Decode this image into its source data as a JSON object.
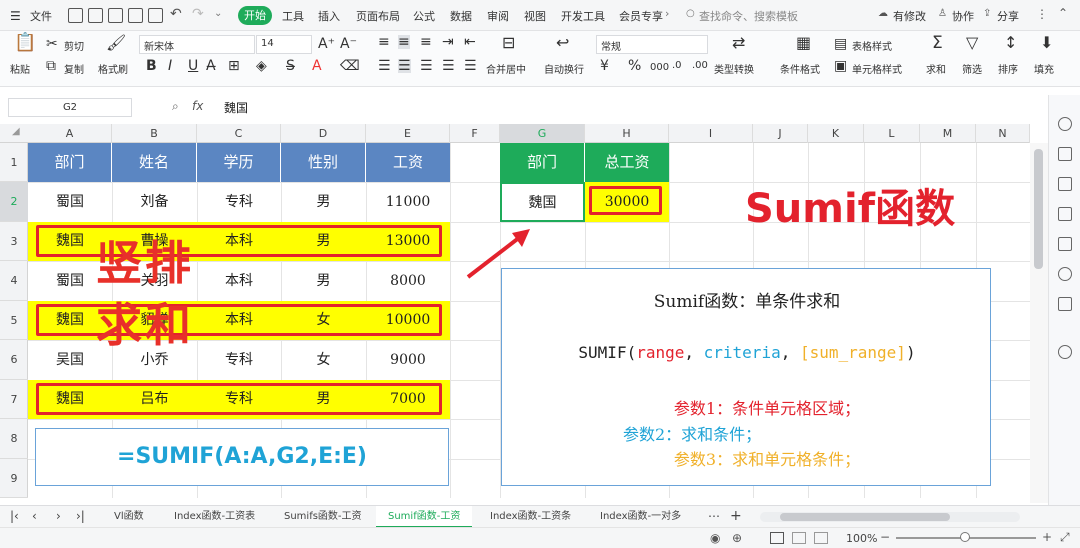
{
  "menubar": {
    "file": "文件",
    "tabs": [
      "开始",
      "工具",
      "插入",
      "页面布局",
      "公式",
      "数据",
      "审阅",
      "视图",
      "开发工具",
      "会员专享"
    ],
    "search_placeholder": "查找命令、搜索模板",
    "has_edit": "有修改",
    "collab": "协作",
    "share": "分享"
  },
  "toolbar": {
    "paste": "粘贴",
    "cut": "剪切",
    "copy": "复制",
    "format_painter": "格式刷",
    "font_name": "新宋体",
    "font_size": "14",
    "merge_center": "合并居中",
    "wrap_text": "自动换行",
    "number_format": "常规",
    "type_convert": "类型转换",
    "cond_format": "条件格式",
    "table_style": "表格样式",
    "cell_style": "单元格样式",
    "sum": "求和",
    "filter": "筛选",
    "sort": "排序",
    "fill": "填充",
    "currency_symbol": "¥",
    "percent_symbol": "%",
    "thousands_symbol": "000"
  },
  "formula_bar": {
    "cell_ref": "G2",
    "fx": "fx",
    "content": "魏国"
  },
  "columns": [
    "A",
    "B",
    "C",
    "D",
    "E",
    "F",
    "G",
    "H",
    "I",
    "J",
    "K",
    "L",
    "M",
    "N"
  ],
  "rows": [
    "1",
    "2",
    "3",
    "4",
    "5",
    "6",
    "7",
    "8",
    "9"
  ],
  "table": {
    "headers": [
      "部门",
      "姓名",
      "学历",
      "性别",
      "工资"
    ],
    "rows": [
      [
        "蜀国",
        "刘备",
        "专科",
        "男",
        "11000"
      ],
      [
        "魏国",
        "曹操",
        "本科",
        "男",
        "13000"
      ],
      [
        "蜀国",
        "关羽",
        "本科",
        "男",
        "8000"
      ],
      [
        "魏国",
        "貂蝉",
        "本科",
        "女",
        "10000"
      ],
      [
        "吴国",
        "小乔",
        "专科",
        "女",
        "9000"
      ],
      [
        "魏国",
        "吕布",
        "专科",
        "男",
        "7000"
      ]
    ]
  },
  "result_table": {
    "headers": [
      "部门",
      "总工资"
    ],
    "dept": "魏国",
    "total": "30000"
  },
  "overlay": {
    "vertical_sum": "竖排",
    "vertical_sum2": "求和",
    "sumif_title": "Sumif函数"
  },
  "formula_display": "=SUMIF(A:A,G2,E:E)",
  "info": {
    "title": "Sumif函数：单条件求和",
    "syntax_fn": "SUMIF(",
    "syntax_range": "range",
    "syntax_sep1": ", ",
    "syntax_criteria": "criteria",
    "syntax_sep2": ", ",
    "syntax_sum_range": "[sum_range]",
    "syntax_close": ")",
    "param1": "参数1：条件单元格区域；",
    "param2": "参数2：求和条件；",
    "param3": "参数3：求和单元格条件；"
  },
  "sheets": [
    "Vl函数",
    "Index函数-工资表",
    "Sumifs函数-工资",
    "Sumif函数-工资",
    "Index函数-工资条",
    "Index函数-一对多"
  ],
  "active_sheet": "Sumif函数-工资",
  "status": {
    "zoom": "100%"
  },
  "colors": {
    "accent_green": "#1eab5a",
    "header_blue": "#5b86c2",
    "highlight_yellow": "#ffff00",
    "red": "#e3222d",
    "param2_blue": "#1fa3d6",
    "param3_orange": "#f0b029"
  }
}
